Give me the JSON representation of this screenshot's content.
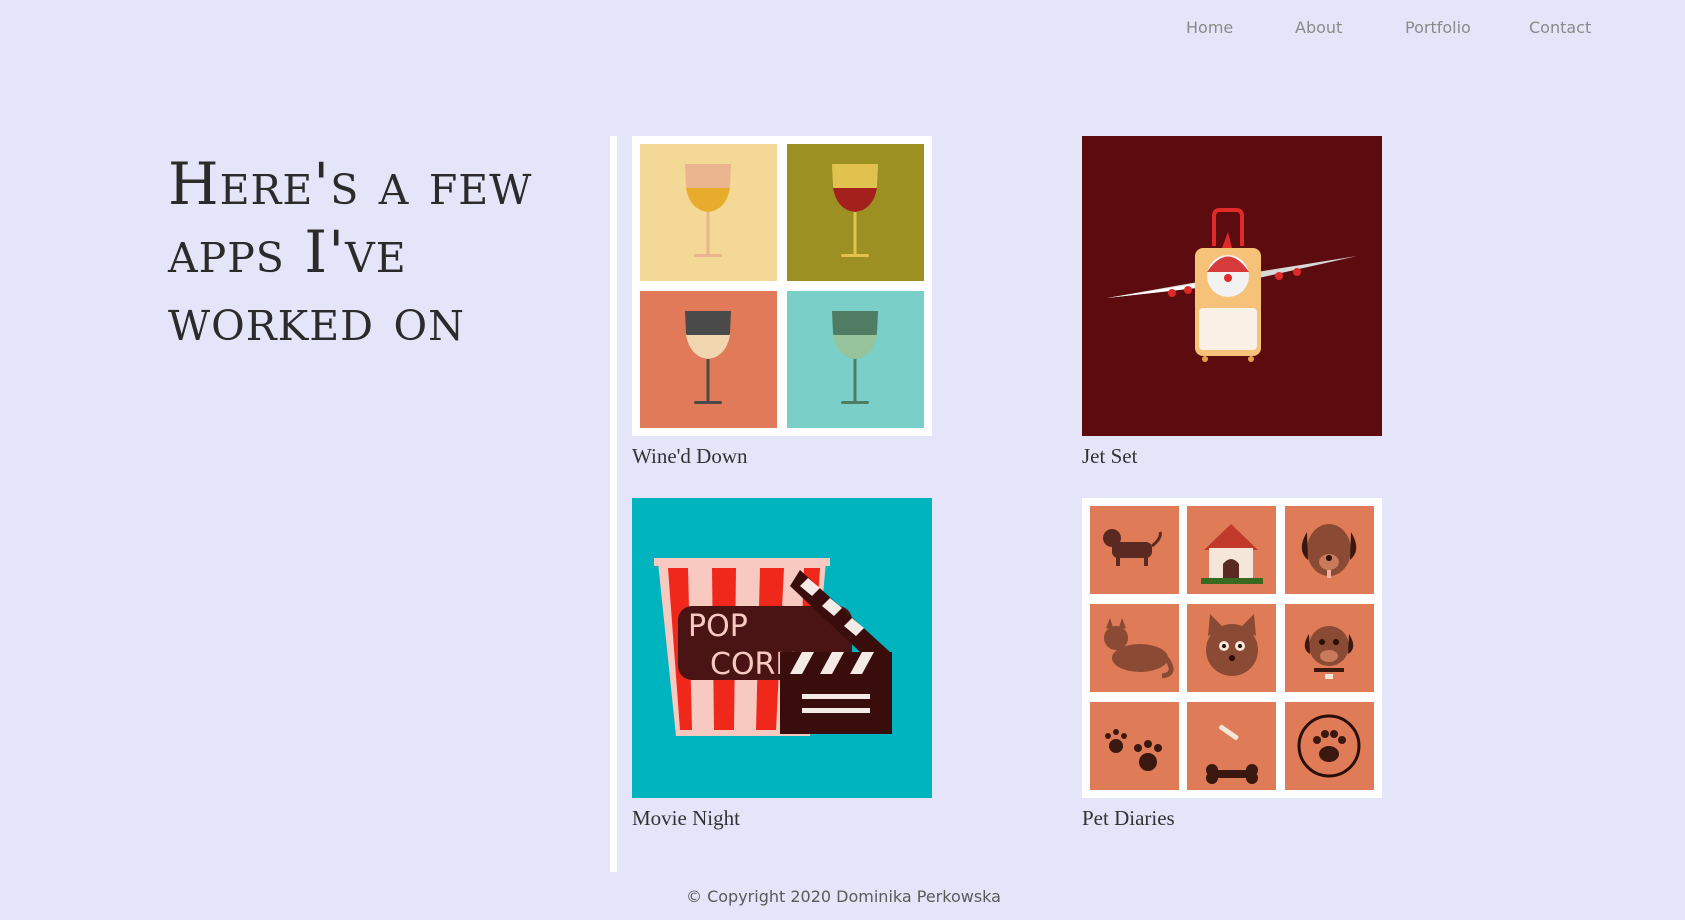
{
  "nav": {
    "items": [
      {
        "label": "Home"
      },
      {
        "label": "About"
      },
      {
        "label": "Portfolio"
      },
      {
        "label": "Contact"
      }
    ]
  },
  "heading": "Here's a few apps I've worked on",
  "portfolio": {
    "projects": [
      {
        "title": "Wine'd Down",
        "image_icon": "wine-glasses-icon"
      },
      {
        "title": "Jet Set",
        "image_icon": "airplane-suitcase-icon"
      },
      {
        "title": "Movie Night",
        "image_icon": "popcorn-clapperboard-icon",
        "image_text": [
          "POP",
          "CORN"
        ]
      },
      {
        "title": "Pet Diaries",
        "image_icon": "pet-icons-grid-icon"
      }
    ]
  },
  "footer": {
    "copyright": "© Copyright 2020 Dominika Perkowska"
  },
  "colors": {
    "background": "#e5e5f9",
    "jetset_bg": "#5c0b0e",
    "movie_bg": "#00b4bf",
    "pet_tile": "#e07b58"
  }
}
